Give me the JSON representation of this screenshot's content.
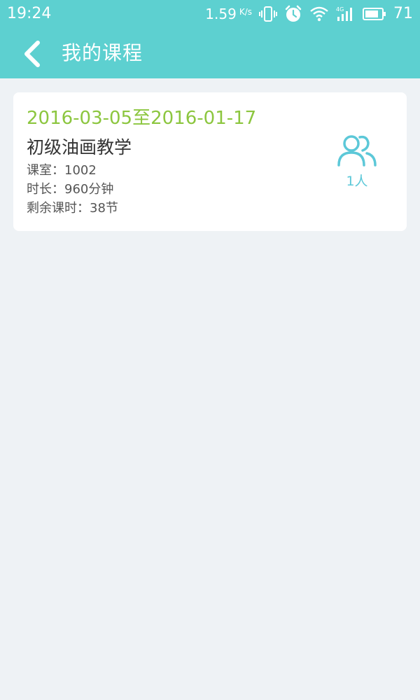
{
  "status_bar": {
    "time": "19:24",
    "net_speed": "1.59",
    "net_unit": "K/s",
    "battery_percent": "71",
    "icons": [
      "vibrate-icon",
      "alarm-icon",
      "wifi-icon",
      "signal-4g-icon",
      "battery-icon"
    ]
  },
  "header": {
    "back_icon": "chevron-left-icon",
    "title": "我的课程"
  },
  "colors": {
    "header_bg": "#5dd0d0",
    "page_bg": "#eef2f5",
    "date_green": "#8cc63f",
    "accent_teal": "#5cc8d8"
  },
  "courses": [
    {
      "date_range": "2016-03-05至2016-01-17",
      "name": "初级油画教学",
      "room": "课室：1002",
      "duration": "时长：960分钟",
      "remaining": "剩余课时：38节",
      "people_icon": "users-icon",
      "people_count": "1人"
    }
  ]
}
